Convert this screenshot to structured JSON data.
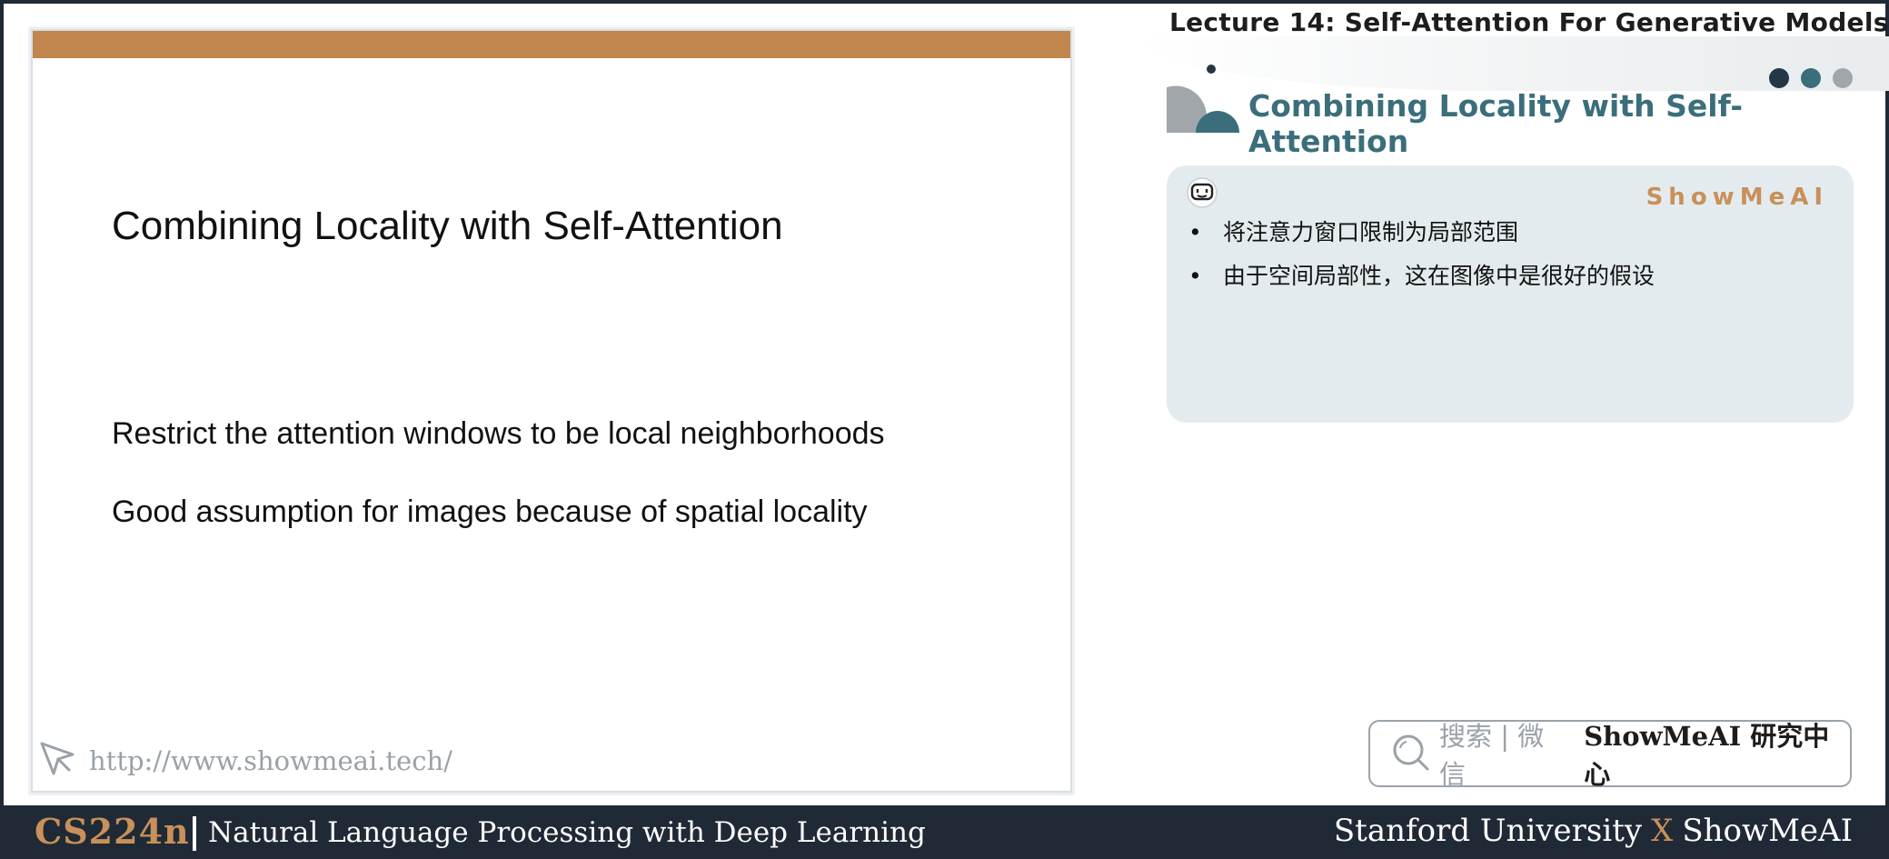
{
  "header": {
    "lecture_title": "Lecture 14:  Self-Attention For Generative Models",
    "section_title": "Combining Locality with Self-Attention",
    "dot_colors": [
      "#243746",
      "#3b6e7b",
      "#a0a6a9"
    ]
  },
  "slide": {
    "accent_color": "#c0864e",
    "title": "Combining Locality with Self-Attention",
    "bullets": [
      "Restrict the attention windows to be local neighborhoods",
      "Good assumption for images because of spatial locality"
    ],
    "url": "http://www.showmeai.tech/",
    "url_icon": "cursor-arrow-icon"
  },
  "note": {
    "brand": "ShowMeAI",
    "icon": "robot-face-icon",
    "bullets": [
      "将注意力窗口限制为局部范围",
      "由于空间局部性，这在图像中是很好的假设"
    ]
  },
  "search": {
    "icon": "search-icon",
    "label": "搜索 | 微信",
    "brand": "ShowMeAI 研究中心"
  },
  "footer": {
    "course_code": "CS224n",
    "course_name": "Natural Language Processing with Deep Learning",
    "university": "Stanford University",
    "separator": "X",
    "partner": "ShowMeAI",
    "accent_color": "#c8905a",
    "background_color": "#1f2a36"
  }
}
